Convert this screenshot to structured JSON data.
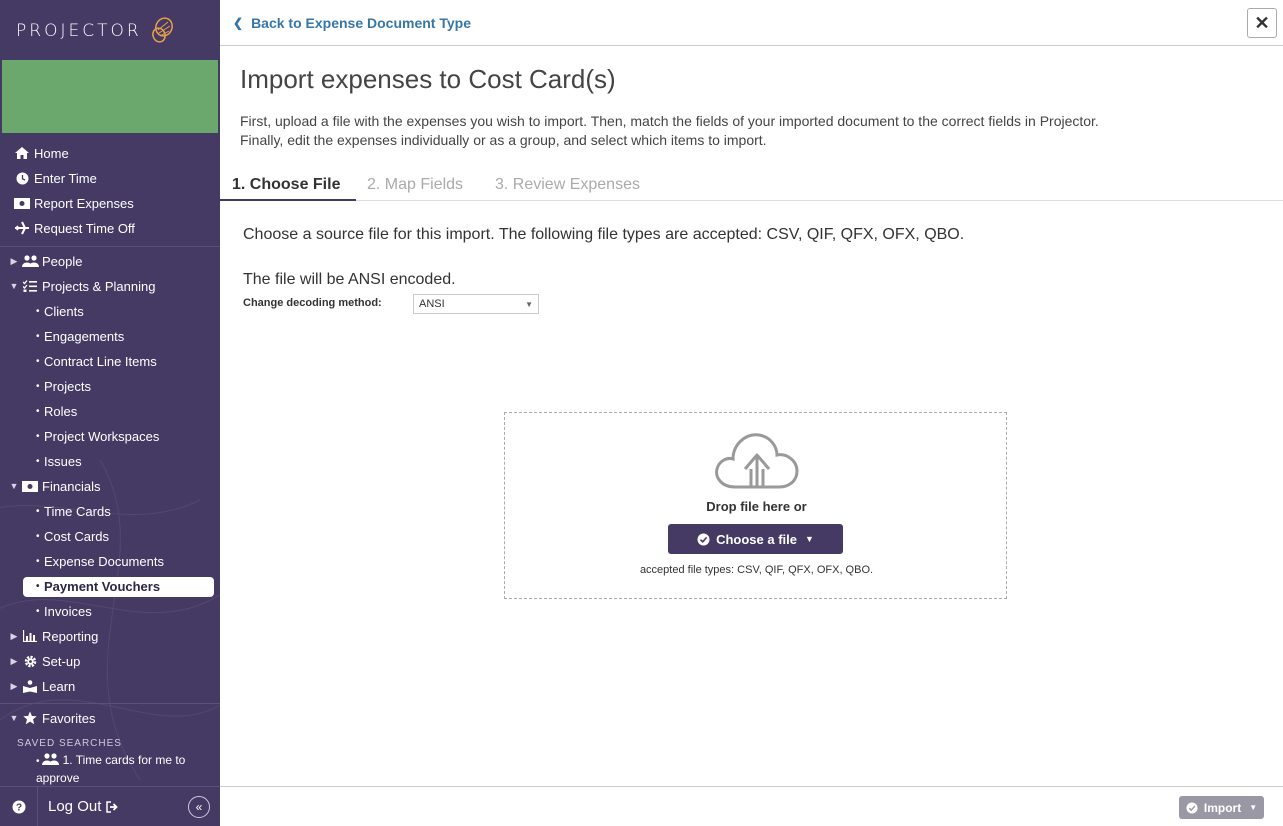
{
  "app": {
    "logo_text": "PROJECTOR"
  },
  "sidebar": {
    "nav": [
      {
        "label": "Home",
        "icon": "home-icon"
      },
      {
        "label": "Enter Time",
        "icon": "clock-icon"
      },
      {
        "label": "Report Expenses",
        "icon": "money-icon"
      },
      {
        "label": "Request Time Off",
        "icon": "plane-icon"
      }
    ],
    "sections": {
      "people": "People",
      "projects": "Projects & Planning",
      "projects_items": [
        "Clients",
        "Engagements",
        "Contract Line Items",
        "Projects",
        "Roles",
        "Project Workspaces",
        "Issues"
      ],
      "financials": "Financials",
      "financials_items": [
        "Time Cards",
        "Cost Cards",
        "Expense Documents",
        "Payment Vouchers",
        "Invoices"
      ],
      "reporting": "Reporting",
      "setup": "Set-up",
      "learn": "Learn",
      "favorites": "Favorites"
    },
    "active_item": "Payment Vouchers",
    "saved_searches_title": "SAVED SEARCHES",
    "saved_search_item": "1. Time cards for me to approve",
    "logout_label": "Log Out",
    "help_label": "?",
    "collapse_label": "«"
  },
  "header": {
    "back_label": "Back to Expense Document Type",
    "close_label": "✕"
  },
  "main": {
    "title": "Import expenses to Cost Card(s)",
    "intro": "First, upload a file with the expenses you wish to import. Then, match the fields of your imported document to the correct fields in Projector. Finally, edit the expenses individually or as a group, and select which items to import.",
    "tabs": [
      "1. Choose File",
      "2. Map Fields",
      "3. Review Expenses"
    ],
    "active_tab": 0,
    "source_text": "Choose a source file for this import. The following file types are accepted: CSV, QIF, QFX, OFX, QBO.",
    "encoding_text": "The file will be ANSI encoded.",
    "decode_label": "Change decoding method:",
    "decode_value": "ANSI",
    "dropzone": {
      "drop_text": "Drop file here or",
      "choose_label": "Choose a file",
      "accepted": "accepted file types: CSV, QIF, QFX, OFX, QBO."
    }
  },
  "footer": {
    "import_label": "Import"
  },
  "colors": {
    "sidebar_bg": "#443a63",
    "banner": "#6aa86d",
    "link": "#3677a8",
    "primary_button": "#443a63",
    "disabled_button": "#9b98a6"
  }
}
